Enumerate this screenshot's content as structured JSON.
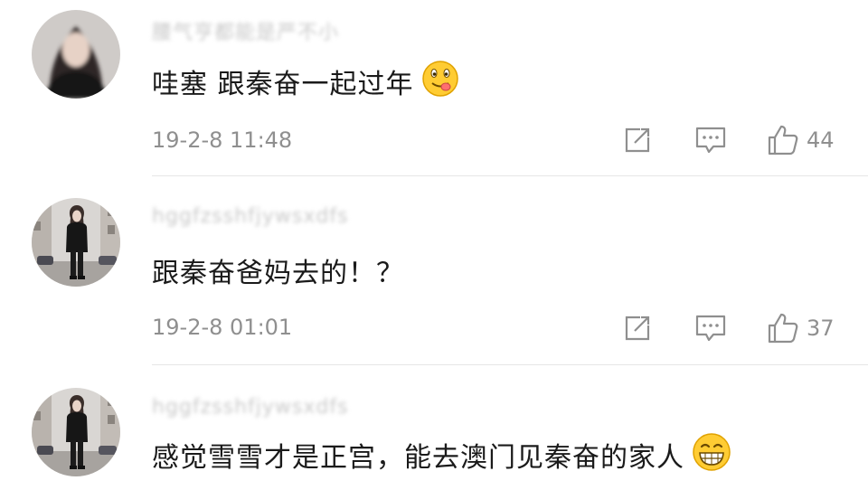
{
  "comments": [
    {
      "username": "腰气亨都能是严不小",
      "text": "哇塞 跟秦奋一起过年",
      "emoji": "drooling-face-emoji",
      "timestamp": "19-2-8 11:48",
      "likes": "44",
      "avatar": "blurred-avatar"
    },
    {
      "username": "hggfzsshfjywsxdfs",
      "text": "跟秦奋爸妈去的！？",
      "emoji": "",
      "timestamp": "19-2-8 01:01",
      "likes": "37",
      "avatar": "standing-woman-avatar"
    },
    {
      "username": "hggfzsshfjywsxdfs",
      "text": "感觉雪雪才是正宫，能去澳门见秦奋的家人",
      "emoji": "grinning-face-emoji",
      "timestamp": "",
      "likes": "",
      "avatar": "standing-woman-avatar"
    }
  ],
  "colors": {
    "text": "#1a1a1a",
    "meta": "#8f8f8f",
    "divider": "#e6e6e6"
  }
}
